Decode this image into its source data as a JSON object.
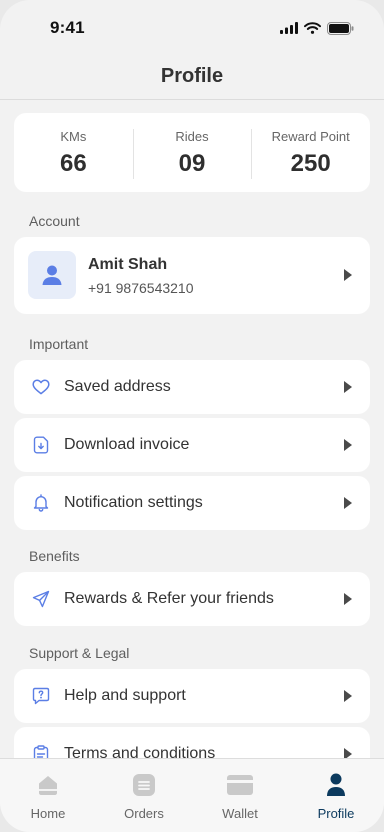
{
  "status_bar": {
    "time": "9:41"
  },
  "header": {
    "title": "Profile"
  },
  "stats": [
    {
      "label": "KMs",
      "value": "66"
    },
    {
      "label": "Rides",
      "value": "09"
    },
    {
      "label": "Reward Point",
      "value": "250"
    }
  ],
  "sections": {
    "account": "Account",
    "important": "Important",
    "benefits": "Benefits",
    "support": "Support & Legal"
  },
  "account": {
    "name": "Amit Shah",
    "phone": "+91 9876543210"
  },
  "important_items": [
    {
      "label": "Saved address",
      "icon": "heart-icon"
    },
    {
      "label": "Download invoice",
      "icon": "invoice-icon"
    },
    {
      "label": "Notification settings",
      "icon": "bell-icon"
    }
  ],
  "benefit_items": [
    {
      "label": "Rewards & Refer your friends",
      "icon": "send-icon"
    }
  ],
  "support_items": [
    {
      "label": "Help and support",
      "icon": "help-icon"
    },
    {
      "label": "Terms and conditions",
      "icon": "clipboard-icon"
    }
  ],
  "tabs": [
    {
      "label": "Home",
      "icon": "home-icon",
      "active": false
    },
    {
      "label": "Orders",
      "icon": "orders-icon",
      "active": false
    },
    {
      "label": "Wallet",
      "icon": "wallet-icon",
      "active": false
    },
    {
      "label": "Profile",
      "icon": "profile-icon",
      "active": true
    }
  ],
  "colors": {
    "accent": "#5b7ee5",
    "active_tab": "#0c3a5e",
    "background": "#f2f2f2"
  }
}
